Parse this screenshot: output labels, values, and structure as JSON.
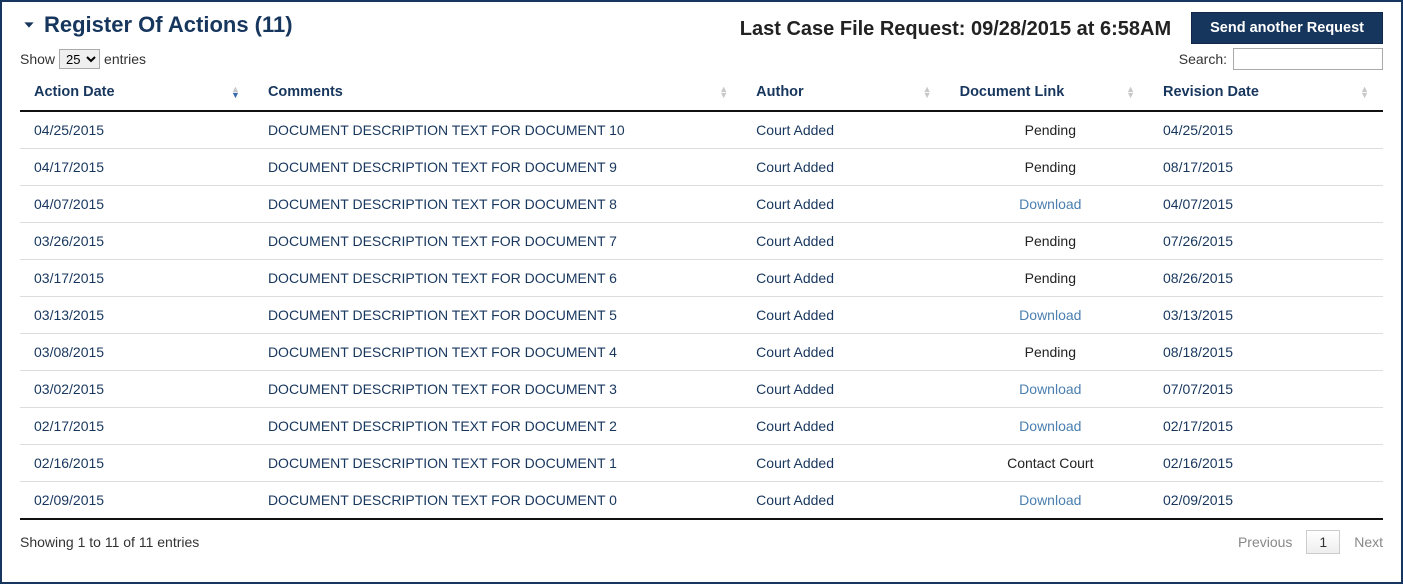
{
  "header": {
    "title": "Register Of Actions (11)",
    "last_request": "Last Case File Request: 09/28/2015 at 6:58AM",
    "send_button": "Send another Request"
  },
  "controls": {
    "show_prefix": "Show",
    "show_suffix": "entries",
    "entries_value": "25",
    "search_label": "Search:"
  },
  "columns": {
    "action_date": "Action Date",
    "comments": "Comments",
    "author": "Author",
    "document_link": "Document Link",
    "revision_date": "Revision Date"
  },
  "rows": [
    {
      "action_date": "04/25/2015",
      "comments": "DOCUMENT DESCRIPTION TEXT FOR DOCUMENT 10",
      "author": "Court Added",
      "doc": "Pending",
      "doc_type": "status",
      "revision": "04/25/2015"
    },
    {
      "action_date": "04/17/2015",
      "comments": "DOCUMENT DESCRIPTION TEXT FOR DOCUMENT 9",
      "author": "Court Added",
      "doc": "Pending",
      "doc_type": "status",
      "revision": "08/17/2015"
    },
    {
      "action_date": "04/07/2015",
      "comments": "DOCUMENT DESCRIPTION TEXT FOR DOCUMENT 8",
      "author": "Court Added",
      "doc": "Download",
      "doc_type": "link",
      "revision": "04/07/2015"
    },
    {
      "action_date": "03/26/2015",
      "comments": "DOCUMENT DESCRIPTION TEXT FOR DOCUMENT 7",
      "author": "Court Added",
      "doc": "Pending",
      "doc_type": "status",
      "revision": "07/26/2015"
    },
    {
      "action_date": "03/17/2015",
      "comments": "DOCUMENT DESCRIPTION TEXT FOR DOCUMENT 6",
      "author": "Court Added",
      "doc": "Pending",
      "doc_type": "status",
      "revision": "08/26/2015"
    },
    {
      "action_date": "03/13/2015",
      "comments": "DOCUMENT DESCRIPTION TEXT FOR DOCUMENT 5",
      "author": "Court Added",
      "doc": "Download",
      "doc_type": "link",
      "revision": "03/13/2015"
    },
    {
      "action_date": "03/08/2015",
      "comments": "DOCUMENT DESCRIPTION TEXT FOR DOCUMENT 4",
      "author": "Court Added",
      "doc": "Pending",
      "doc_type": "status",
      "revision": "08/18/2015"
    },
    {
      "action_date": "03/02/2015",
      "comments": "DOCUMENT DESCRIPTION TEXT FOR DOCUMENT 3",
      "author": "Court Added",
      "doc": "Download",
      "doc_type": "link",
      "revision": "07/07/2015"
    },
    {
      "action_date": "02/17/2015",
      "comments": "DOCUMENT DESCRIPTION TEXT FOR DOCUMENT 2",
      "author": "Court Added",
      "doc": "Download",
      "doc_type": "link",
      "revision": "02/17/2015"
    },
    {
      "action_date": "02/16/2015",
      "comments": "DOCUMENT DESCRIPTION TEXT FOR DOCUMENT 1",
      "author": "Court Added",
      "doc": "Contact Court",
      "doc_type": "status",
      "revision": "02/16/2015"
    },
    {
      "action_date": "02/09/2015",
      "comments": "DOCUMENT DESCRIPTION TEXT FOR DOCUMENT 0",
      "author": "Court Added",
      "doc": "Download",
      "doc_type": "link",
      "revision": "02/09/2015"
    }
  ],
  "footer": {
    "info": "Showing 1 to 11 of 11 entries",
    "previous": "Previous",
    "next": "Next",
    "current_page": "1"
  }
}
